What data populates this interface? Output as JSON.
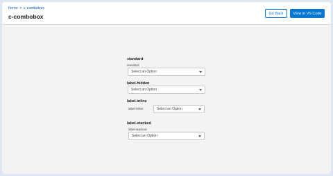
{
  "header": {
    "breadcrumb": {
      "home": "home",
      "separator": ">",
      "current": "c-combobox"
    },
    "title": "c-combobox",
    "buttons": {
      "go_back": "Go Back",
      "view_vscode": "View in VS Code"
    }
  },
  "examples": [
    {
      "title": "standard",
      "label": "standard",
      "placeholder": "Select an Option"
    },
    {
      "title": "label-hidden",
      "label": "",
      "placeholder": "Select an Option"
    },
    {
      "title": "label-inline",
      "label": "label-inline",
      "placeholder": "Select an Option"
    },
    {
      "title": "label-stacked",
      "label": "label-stacked",
      "placeholder": "Select an Option"
    }
  ],
  "icons": {
    "combobox_arrow": "chevron-down-icon"
  },
  "colors": {
    "brand": "#0176d3",
    "link": "#0b5cab",
    "background": "#f3f3f3"
  }
}
